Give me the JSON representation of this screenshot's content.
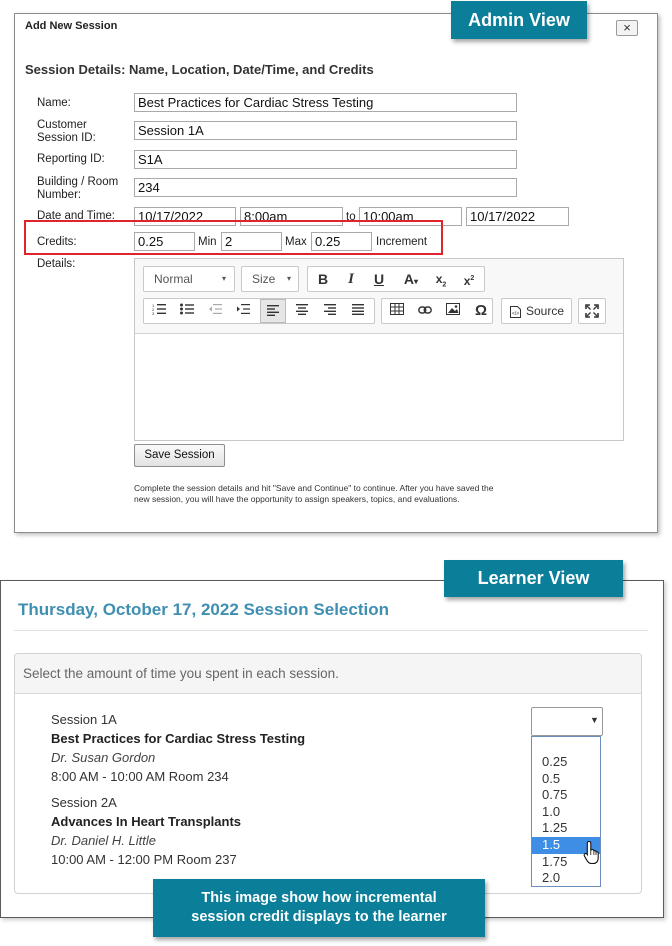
{
  "admin": {
    "badge": "Admin View",
    "dialog_title": "Add New Session",
    "close_glyph": "×",
    "section_heading": "Session Details: Name, Location, Date/Time, and Credits",
    "fields": {
      "name_label": "Name:",
      "name_value": "Best Practices for Cardiac Stress Testing",
      "customer_id_label_1": "Customer",
      "customer_id_label_2": "Session ID:",
      "customer_id_value": "Session 1A",
      "reporting_label": "Reporting ID:",
      "reporting_value": "S1A",
      "room_label_1": "Building / Room",
      "room_label_2": "Number:",
      "room_value": "234",
      "datetime_label": "Date and Time:",
      "start_date": "10/17/2022",
      "start_time": "8:00am",
      "to_label": "to",
      "end_time": "10:00am",
      "end_date": "10/17/2022",
      "credits_label": "Credits:",
      "credits_value": "0.25",
      "min_label": "Min",
      "min_value": "2",
      "max_label": "Max",
      "max_value": "0.25",
      "increment_label": "Increment",
      "details_label": "Details:"
    },
    "editor": {
      "format_combo": "Normal",
      "size_combo": "Size",
      "source_label": "Source"
    },
    "save_button": "Save Session",
    "help_text": "Complete the session details and hit \"Save and Continue\" to continue. After you have saved the new session, you will have the opportunity to assign speakers, topics, and evaluations."
  },
  "learner": {
    "badge": "Learner View",
    "heading": "Thursday, October 17, 2022 Session Selection",
    "instruction": "Select the amount of time you spent in each session.",
    "sessions": [
      {
        "code": "Session 1A",
        "title": "Best Practices for Cardiac Stress Testing",
        "speaker": "Dr. Susan Gordon",
        "time": "8:00 AM - 10:00 AM Room 234"
      },
      {
        "code": "Session 2A",
        "title": "Advances In Heart Transplants",
        "speaker": "Dr. Daniel H. Little",
        "time": "10:00 AM - 12:00 PM Room 237"
      }
    ],
    "dropdown_options": [
      "0.25",
      "0.5",
      "0.75",
      "1.0",
      "1.25",
      "1.5",
      "1.75",
      "2.0"
    ],
    "highlighted_option": "1.5",
    "caption_line1": "This image show how incremental",
    "caption_line2": "session credit displays to the learner"
  },
  "colors": {
    "badge_bg": "#0b7f99",
    "highlight_box": "#e0242c",
    "learner_heading": "#3f8fb1",
    "option_highlight": "#3d8ee4"
  }
}
